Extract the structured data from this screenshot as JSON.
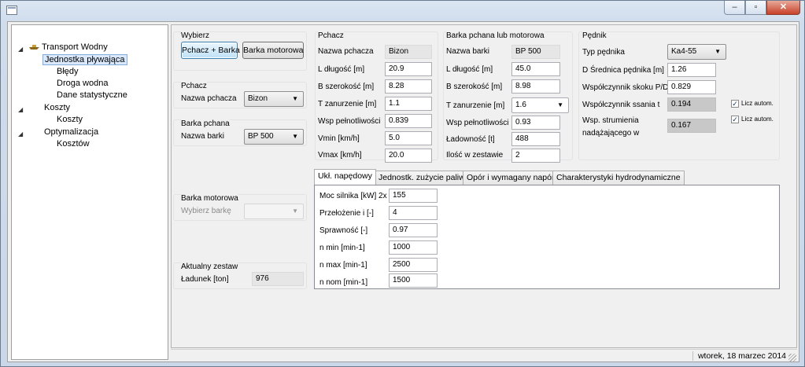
{
  "window": {
    "title": ""
  },
  "tree": {
    "items": [
      {
        "label": "Transport Wodny",
        "level": 0,
        "expanded": true
      },
      {
        "label": "Jednostka pływająca",
        "level": 1,
        "selected": true
      },
      {
        "label": "Błędy",
        "level": 1
      },
      {
        "label": "Droga wodna",
        "level": 1
      },
      {
        "label": "Dane statystyczne",
        "level": 1
      },
      {
        "label": "Koszty",
        "level": 0,
        "expanded": true
      },
      {
        "label": "Koszty",
        "level": 1
      },
      {
        "label": "Optymalizacja",
        "level": 0,
        "expanded": true
      },
      {
        "label": "Kosztów",
        "level": 1
      }
    ]
  },
  "wybierz": {
    "title": "Wybierz",
    "btn_pchacz_barka": "Pchacz + Barka",
    "btn_barka_motorowa": "Barka motorowa"
  },
  "pchacz_select": {
    "title": "Pchacz",
    "label": "Nazwa pchacza",
    "value": "Bizon"
  },
  "barka_pchana_select": {
    "title": "Barka pchana",
    "label": "Nazwa barki",
    "value": "BP 500"
  },
  "barka_motorowa": {
    "title": "Barka motorowa",
    "label": "Wybierz barkę",
    "value": ""
  },
  "zestaw": {
    "title": "Aktualny zestaw",
    "label": "Ładunek [ton]",
    "value": "976"
  },
  "pchacz": {
    "title": "Pchacz",
    "fields": [
      {
        "label": "Nazwa pchacza",
        "value": "Bizon"
      },
      {
        "label": "L długość [m]",
        "value": "20.9"
      },
      {
        "label": "B szerokość [m]",
        "value": "8.28"
      },
      {
        "label": "T zanurzenie [m]",
        "value": "1.1"
      },
      {
        "label": "Wsp pełnotliwości",
        "value": "0.839"
      },
      {
        "label": "Vmin [km/h]",
        "value": "5.0"
      },
      {
        "label": "Vmax [km/h]",
        "value": "20.0"
      }
    ]
  },
  "barka": {
    "title": "Barka pchana lub motorowa",
    "fields": [
      {
        "label": "Nazwa barki",
        "value": "BP 500"
      },
      {
        "label": "L długość [m]",
        "value": "45.0"
      },
      {
        "label": "B szerokość [m]",
        "value": "8.98"
      },
      {
        "label": "T zanurzenie [m]",
        "value": "1.6"
      },
      {
        "label": "Wsp pełnotliwości",
        "value": "0.93"
      },
      {
        "label": "Ładowność [t]",
        "value": "488"
      },
      {
        "label": "Ilość w zestawie",
        "value": "2"
      }
    ]
  },
  "pednik": {
    "title": "Pędnik",
    "typ_label": "Typ pędnika",
    "typ_value": "Ka4-55",
    "srednica_label": "D Średnica pędnika [m]",
    "srednica_value": "1.26",
    "skok_label": "Współczynnik skoku P/D",
    "skok_value": "0.829",
    "ssania_label": "Współczynnik ssania t",
    "ssania_value": "0.194",
    "ssania_chk_label": "Licz autom.",
    "strumienia_label_1": "Wsp. strumienia",
    "strumienia_label_2": "nadążającego w",
    "strumienia_value": "0.167",
    "strumienia_chk_label": "Licz autom."
  },
  "tabs": [
    {
      "label": "Ukł. napędowy",
      "active": true
    },
    {
      "label": "Jednostk. zużycie paliwa"
    },
    {
      "label": "Opór i wymagany napór"
    },
    {
      "label": "Charakterystyki hydrodynamiczne"
    }
  ],
  "naped": {
    "fields": [
      {
        "label": "Moc silnika [kW] 2x",
        "value": "155"
      },
      {
        "label": "Przełożenie i [-]",
        "value": "4"
      },
      {
        "label": "Sprawność [-]",
        "value": "0.97"
      },
      {
        "label": "n min [min-1]",
        "value": "1000"
      },
      {
        "label": "n max [min-1]",
        "value": "2500"
      },
      {
        "label": "n nom [min-1]",
        "value": "1500"
      }
    ]
  },
  "status": {
    "date": "wtorek, 18 marzec 2014"
  }
}
